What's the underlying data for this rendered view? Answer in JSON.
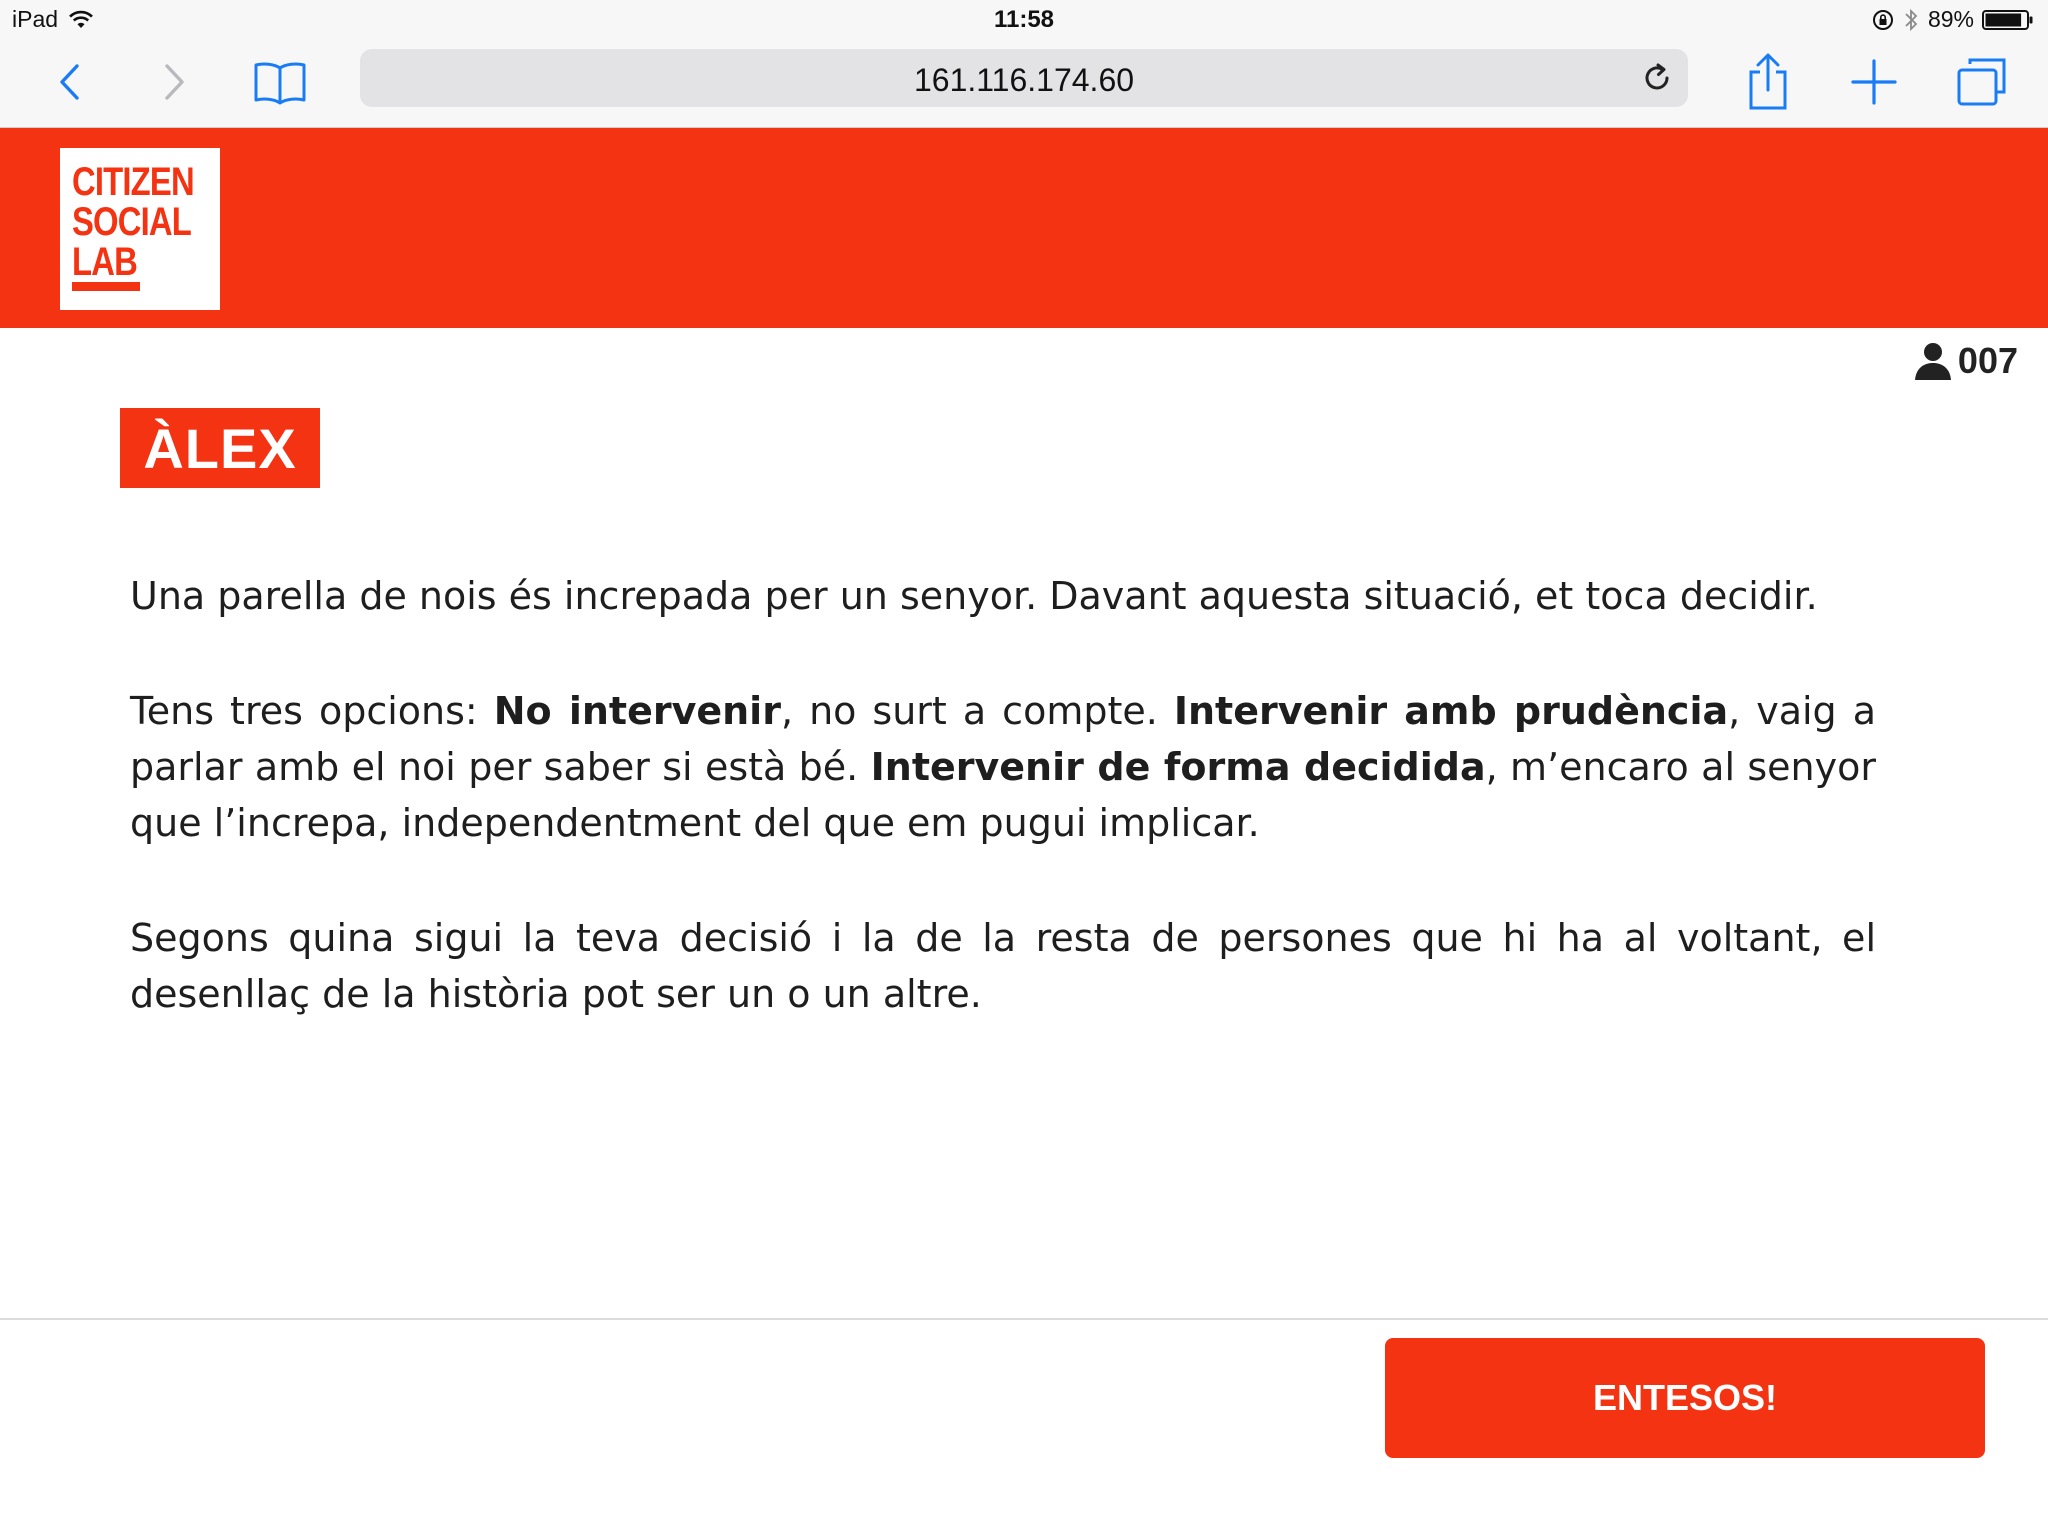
{
  "status_bar": {
    "device": "iPad",
    "time": "11:58",
    "battery_percent": "89%",
    "battery_level": 0.89
  },
  "browser": {
    "url": "161.116.174.60",
    "icon_color": "#1a7cf5"
  },
  "header": {
    "logo_lines": [
      "CITIZEN",
      "SOCIAL",
      "LAB"
    ],
    "brand_color": "#f43312"
  },
  "user": {
    "id": "007"
  },
  "character": {
    "name": "ÀLEX"
  },
  "story": {
    "p1": "Una parella de nois és increpada per un senyor. Davant aquesta situació, et toca decidir.",
    "p2_intro": "Tens tres opcions: ",
    "option1": "No intervenir",
    "option1_desc": ", no surt a compte. ",
    "option2": "Intervenir amb prudència",
    "option2_desc": ", vaig a parlar amb el noi per saber si està bé. ",
    "option3": "Intervenir de forma decidida",
    "option3_desc": ", m’encaro al senyor que l’increpa, independentment del que em pugui implicar.",
    "p3": "Segons quina sigui la teva decisió i la de la resta de persones que hi ha al voltant, el desenllaç de la història pot ser un o un altre."
  },
  "footer": {
    "cta_label": "ENTESOS!"
  }
}
